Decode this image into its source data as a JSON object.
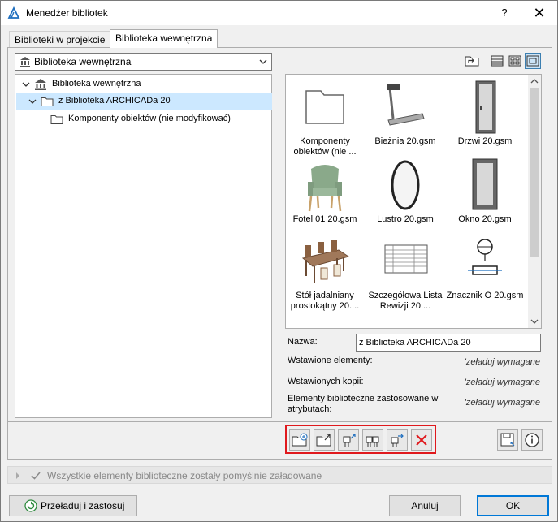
{
  "window": {
    "title": "Menedżer bibliotek",
    "help_label": "?",
    "close_label": "✕"
  },
  "tabs": [
    {
      "label": "Biblioteki w projekcie",
      "active": false
    },
    {
      "label": "Biblioteka wewnętrzna",
      "active": true
    }
  ],
  "library_select": {
    "value": "Biblioteka wewnętrzna",
    "icon": "library-icon"
  },
  "tree": [
    {
      "label": "Biblioteka wewnętrzna",
      "icon": "library-icon",
      "expanded": true,
      "level": 0
    },
    {
      "label": "z Biblioteka ARCHICADa 20",
      "icon": "folder-icon",
      "expanded": true,
      "level": 1,
      "selected": true
    },
    {
      "label": "Komponenty obiektów (nie modyfikować)",
      "icon": "folder-icon",
      "level": 2
    }
  ],
  "view_buttons": [
    {
      "name": "folder-up-button",
      "icon": "folder-up-icon"
    },
    {
      "name": "list-view-button",
      "icon": "list-view-icon"
    },
    {
      "name": "small-icons-view-button",
      "icon": "small-grid-icon"
    },
    {
      "name": "large-icons-view-button",
      "icon": "large-grid-icon",
      "active": true
    }
  ],
  "grid_items": [
    {
      "label": "Komponenty obiektów (nie ...",
      "icon": "folder-icon"
    },
    {
      "label": "Bieżnia 20.gsm",
      "icon": "treadmill-icon"
    },
    {
      "label": "Drzwi 20.gsm",
      "icon": "door-icon"
    },
    {
      "label": "Fotel 01 20.gsm",
      "icon": "armchair-icon"
    },
    {
      "label": "Lustro 20.gsm",
      "icon": "mirror-icon"
    },
    {
      "label": "Okno 20.gsm",
      "icon": "window-icon"
    },
    {
      "label": "Stół jadalniany prostokątny 20....",
      "icon": "dining-table-icon"
    },
    {
      "label": "Szczegółowa Lista Rewizji 20....",
      "icon": "revision-list-icon"
    },
    {
      "label": "Znacznik O 20.gsm",
      "icon": "marker-icon"
    }
  ],
  "properties": {
    "name_label": "Nazwa:",
    "name_value": "z Biblioteka ARCHICADa 20",
    "placed_label": "Wstawione elementy:",
    "placed_value": "'zeładuj wymagane",
    "copies_label": "Wstawionych kopii:",
    "copies_value": "'zeładuj wymagane",
    "attr_label": "Elementy biblioteczne zastosowane w atrybutach:",
    "attr_value": "'zeładuj wymagane"
  },
  "actions": [
    {
      "name": "new-folder-button",
      "icon": "folder-add-icon"
    },
    {
      "name": "import-folder-button",
      "icon": "folder-import-icon"
    },
    {
      "name": "add-element-button",
      "icon": "element-add-icon"
    },
    {
      "name": "add-elements-button",
      "icon": "elements-add-icon"
    },
    {
      "name": "move-element-button",
      "icon": "element-move-icon"
    },
    {
      "name": "delete-button",
      "icon": "delete-x-icon"
    }
  ],
  "side_buttons": [
    {
      "name": "save-button",
      "icon": "save-icon"
    },
    {
      "name": "info-button",
      "icon": "info-icon"
    }
  ],
  "status": {
    "text": "Wszystkie elementy biblioteczne zostały pomyślnie załadowane"
  },
  "footer": {
    "reload_label": "Przeładuj i zastosuj",
    "cancel_label": "Anuluj",
    "ok_label": "OK"
  },
  "colors": {
    "accent": "#0078d7",
    "selection": "#cce8ff",
    "highlight_border": "#e0191d",
    "delete_red": "#e0191d"
  }
}
